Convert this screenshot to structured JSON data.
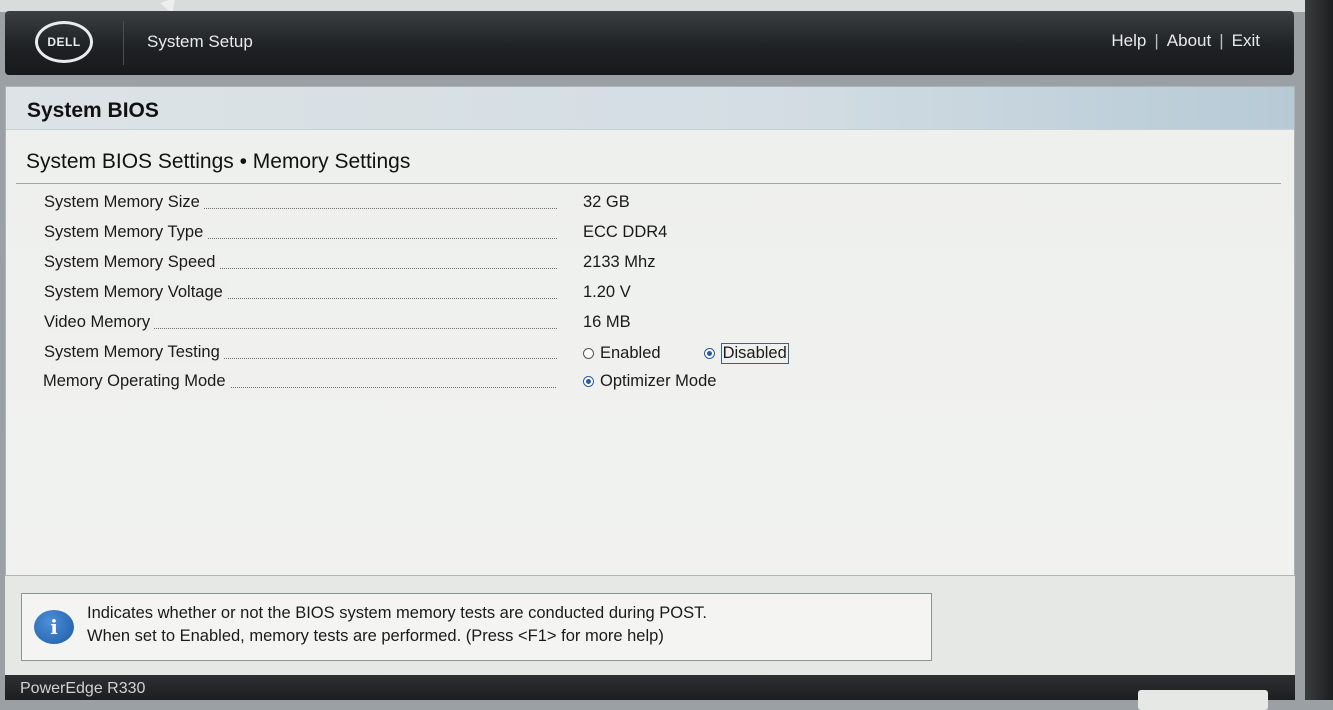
{
  "header": {
    "logo": "DELL",
    "title": "System Setup",
    "nav": [
      {
        "label": "Help"
      },
      {
        "label": "About"
      },
      {
        "label": "Exit"
      }
    ],
    "separator": "|"
  },
  "panel": {
    "title": "System BIOS",
    "section_title": "System BIOS Settings • Memory Settings"
  },
  "settings": [
    {
      "label": "System Memory Size",
      "value": "32 GB"
    },
    {
      "label": "System Memory Type",
      "value": "ECC DDR4"
    },
    {
      "label": "System Memory Speed",
      "value": "2133 Mhz"
    },
    {
      "label": "System Memory Voltage",
      "value": "1.20 V"
    },
    {
      "label": "Video Memory",
      "value": "16 MB"
    }
  ],
  "memory_testing": {
    "label": "System Memory Testing",
    "options": [
      {
        "label": "Enabled",
        "selected": false
      },
      {
        "label": "Disabled",
        "selected": true
      }
    ]
  },
  "operating_mode": {
    "label": "Memory Operating Mode",
    "options": [
      {
        "label": "Optimizer Mode",
        "selected": true
      }
    ]
  },
  "help": {
    "icon": "info-icon",
    "line1": "Indicates whether or not the BIOS system memory tests are conducted during POST.",
    "line2": "When set to Enabled, memory tests are performed. (Press <F1> for more help)"
  },
  "footer": {
    "model": "PowerEdge R330"
  },
  "colors": {
    "header_bg": "#1f2224",
    "accent": "#2a5aa0",
    "info_blue": "#1c5aa8"
  }
}
